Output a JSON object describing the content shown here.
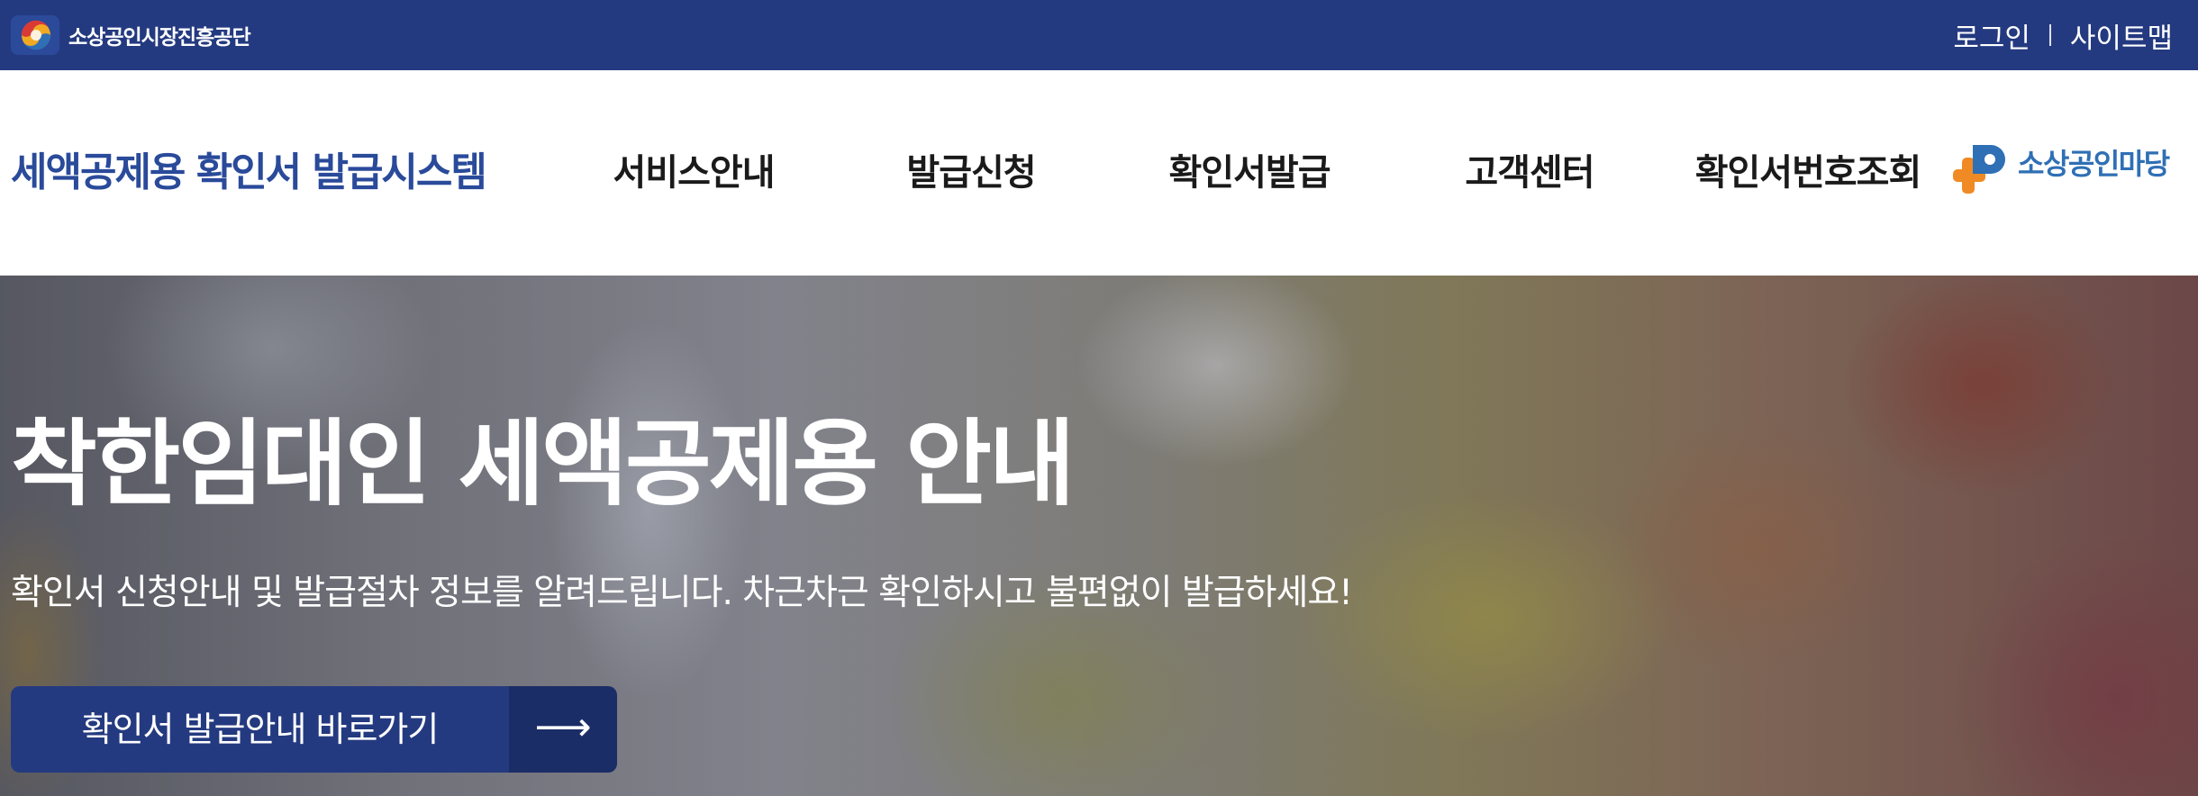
{
  "topbar": {
    "org_name": "소상공인시장진흥공단",
    "org_logo_icon": "semas-emblem-icon",
    "links": {
      "login": "로그인",
      "sitemap": "사이트맵"
    }
  },
  "header": {
    "site_title": "세액공제용 확인서 발급시스템",
    "nav": [
      {
        "label": "서비스안내"
      },
      {
        "label": "발급신청"
      },
      {
        "label": "확인서발급"
      },
      {
        "label": "고객센터"
      },
      {
        "label": "확인서번호조회"
      }
    ],
    "partner_logo": {
      "name": "소상공인마당",
      "icon": "sbiz-madang-logo-icon"
    }
  },
  "hero": {
    "title": "착한임대인 세액공제용 안내",
    "description": "확인서 신청안내 및 발급절차 정보를 알려드립니다. 차근차근 확인하시고 불편없이 발급하세요!",
    "cta_label": "확인서 발급안내 바로가기",
    "cta_icon": "arrow-right-icon",
    "cta_arrow_glyph": "⟶"
  },
  "colors": {
    "brand_navy": "#243a80",
    "title_blue": "#2a4a9a",
    "cta_arrow_bg": "#1b2d66",
    "madang_orange": "#f08a24",
    "madang_blue": "#2f6fb5"
  }
}
